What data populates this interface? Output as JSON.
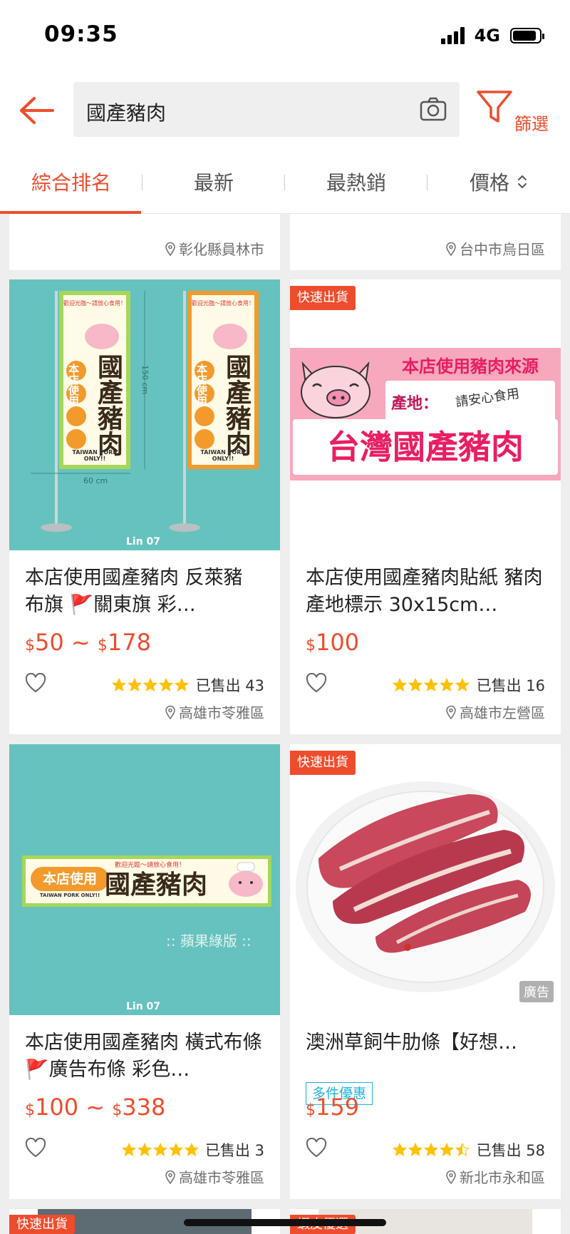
{
  "status_bar": {
    "time": "09:35",
    "network": "4G",
    "signal_bars": 4,
    "battery_level": 0.9
  },
  "search": {
    "query": "國產豬肉",
    "filter_label": "篩選",
    "icons": [
      "back-arrow-icon",
      "camera-icon",
      "filter-icon"
    ]
  },
  "sort_tabs": [
    {
      "label": "綜合排名",
      "active": true
    },
    {
      "label": "最新",
      "active": false
    },
    {
      "label": "最熱銷",
      "active": false
    },
    {
      "label": "價格",
      "active": false
    }
  ],
  "colors": {
    "accent": "#ee4d2d",
    "star": "#ffc107",
    "promo": "#1bb5d9",
    "teal_bg": "#66c2be",
    "pink_bg": "#f7a8bd"
  },
  "partial_row": [
    {
      "location": "彰化縣員林市"
    },
    {
      "location": "台中市烏日區"
    }
  ],
  "products": [
    {
      "title": "本店使用國產豬肉 反萊豬 布旗 🚩關東旗 彩…",
      "price_from": "50",
      "price_to": "178",
      "currency": "$",
      "sold": "已售出 43",
      "rating": 5,
      "location": "高雄市苓雅區",
      "badge": "",
      "thumb_text": {
        "main": "國產豬肉",
        "side": "本店使用",
        "greet": "歡迎光臨～請放心食用！",
        "sub": "TAIWAN PORK ONLY!!",
        "dim_h": "150 cm",
        "dim_w": "60 cm",
        "brand": "Lin 07"
      }
    },
    {
      "title": "本店使用國產豬肉貼紙 豬肉產地標示 30x15cm…",
      "price": "100",
      "currency": "$",
      "sold": "已售出 16",
      "rating": 5,
      "location": "高雄市左營區",
      "badge": "快速出貨",
      "thumb_text": {
        "line1": "本店使用豬肉來源",
        "line2": "產地：",
        "line3": "請安心食用",
        "line4": "台灣國產豬肉"
      }
    },
    {
      "title": "本店使用國產豬肉 橫式布條 🚩廣告布條 彩色…",
      "price_from": "100",
      "price_to": "338",
      "currency": "$",
      "sold": "已售出 3",
      "rating": 5,
      "location": "高雄市苓雅區",
      "badge": "",
      "thumb_text": {
        "main": "國產豬肉",
        "side": "本店使用",
        "greet": "歡迎光臨～請放心食用！",
        "sub": "TAIWAN PORK ONLY!!",
        "variant": ":: 蘋果綠版 ::",
        "brand": "Lin 07"
      }
    },
    {
      "title": "澳洲草飼牛肋條【好想…",
      "price": "159",
      "currency": "$",
      "promo": "多件優惠",
      "sold": "已售出 58",
      "rating": 4.5,
      "location": "新北市永和區",
      "badge": "快速出貨",
      "ad": "廣告"
    }
  ],
  "next_row_badges": [
    "快速出貨",
    "蝦皮優選"
  ]
}
